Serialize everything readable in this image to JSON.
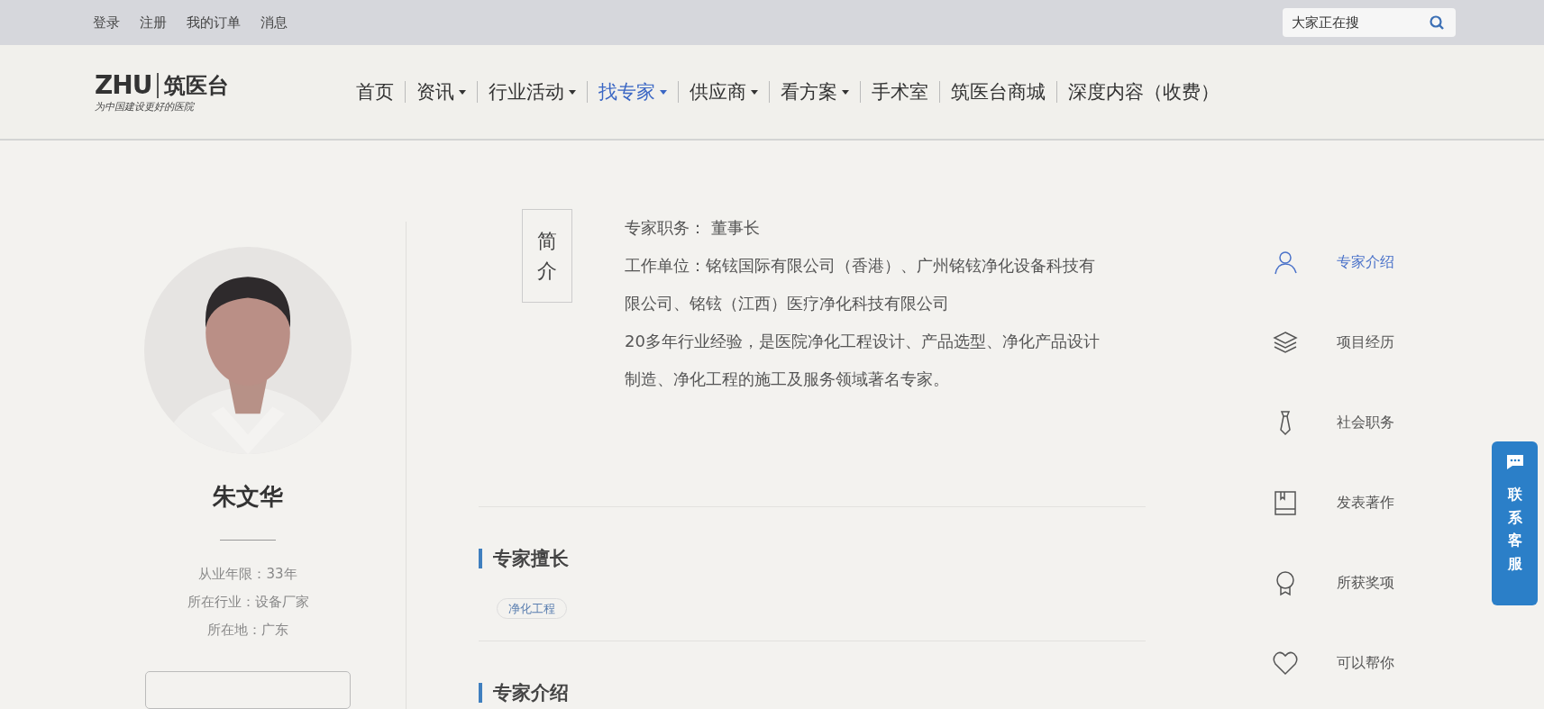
{
  "top_links": [
    "登录",
    "注册",
    "我的订单",
    "消息"
  ],
  "search": {
    "placeholder": "大家正在搜"
  },
  "logo": {
    "mark": "ZHU",
    "name": "筑医台",
    "slogan": "为中国建设更好的医院"
  },
  "nav": [
    {
      "label": "首页",
      "has_menu": false,
      "selected": false
    },
    {
      "label": "资讯",
      "has_menu": true,
      "selected": false
    },
    {
      "label": "行业活动",
      "has_menu": true,
      "selected": false
    },
    {
      "label": "找专家",
      "has_menu": true,
      "selected": true
    },
    {
      "label": "供应商",
      "has_menu": true,
      "selected": false
    },
    {
      "label": "看方案",
      "has_menu": true,
      "selected": false
    },
    {
      "label": "手术室",
      "has_menu": false,
      "selected": false
    },
    {
      "label": "筑医台商城",
      "has_menu": false,
      "selected": false
    },
    {
      "label": "深度内容（收费）",
      "has_menu": false,
      "selected": false
    }
  ],
  "profile": {
    "name": "朱文华",
    "facts": [
      "从业年限：33年",
      "所在行业：设备厂家",
      "所在地：广东"
    ]
  },
  "intro": {
    "badge": "简介",
    "lines": [
      "专家职务： 董事长",
      "工作单位：铭铉国际有限公司（香港）、广州铭铉净化设备科技有限公司、铭铉（江西）医疗净化科技有限公司",
      "20多年行业经验，是医院净化工程设计、产品选型、净化产品设计制造、净化工程的施工及服务领域著名专家。"
    ]
  },
  "sections": [
    {
      "title": "专家擅长",
      "tags": [
        "净化工程"
      ]
    },
    {
      "title": "专家介绍"
    }
  ],
  "side_menu": [
    {
      "label": "专家介绍",
      "selected": true
    },
    {
      "label": "项目经历",
      "selected": false
    },
    {
      "label": "社会职务",
      "selected": false
    },
    {
      "label": "发表著作",
      "selected": false
    },
    {
      "label": "所获奖项",
      "selected": false
    },
    {
      "label": "可以帮你",
      "selected": false
    }
  ],
  "float_button": {
    "label": "联系客服"
  }
}
